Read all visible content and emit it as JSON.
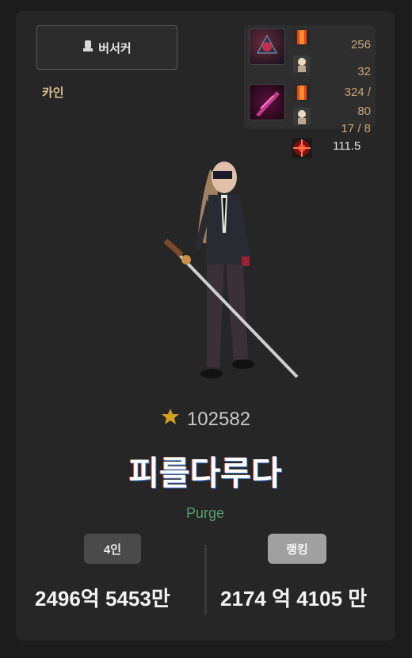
{
  "header": {
    "class_name": "버서커",
    "server": "카인"
  },
  "stats": {
    "stat1": "256",
    "stat2": "32",
    "stat3": "324 /",
    "stat4": "80",
    "stat5": "17 / 8",
    "stat6": "111.5"
  },
  "character": {
    "fame": "102582",
    "name": "피를다루다",
    "guild": "Purge"
  },
  "footer": {
    "badge_party": "4인",
    "badge_rank": "랭킹",
    "damage_party": "2496억 5453만",
    "damage_rank": "2174 억 4105 만"
  },
  "colors": {
    "accent_stat": "#c7a67b",
    "guild": "#55a06c"
  }
}
